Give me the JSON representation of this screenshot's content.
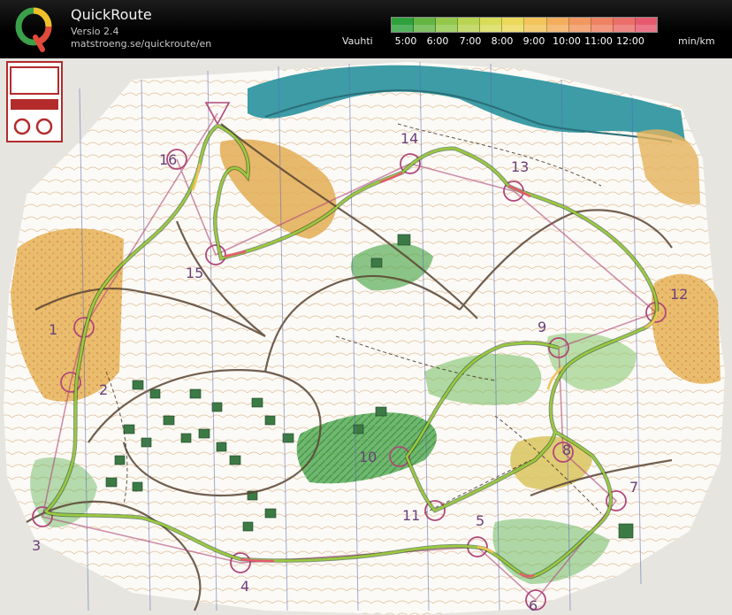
{
  "app": {
    "name": "QuickRoute",
    "version": "Versio 2.4",
    "url": "matstroeng.se/quickroute/en",
    "logo_letter": "Q"
  },
  "legend": {
    "label": "Vauhti",
    "unit": "min/km",
    "ticks": [
      "5:00",
      "6:00",
      "7:00",
      "8:00",
      "9:00",
      "10:00",
      "11:00",
      "12:00"
    ],
    "colors": [
      "#2fa13c",
      "#64b544",
      "#93c84b",
      "#b9d451",
      "#d8dc57",
      "#ecd85a",
      "#f2c45a",
      "#f3ad5c",
      "#f1975f",
      "#ee8263",
      "#ea6e69",
      "#e65a6f"
    ]
  },
  "map": {
    "controls": [
      {
        "id": "1",
        "label": "1"
      },
      {
        "id": "2",
        "label": "2"
      },
      {
        "id": "3",
        "label": "3"
      },
      {
        "id": "4",
        "label": "4"
      },
      {
        "id": "5",
        "label": "5"
      },
      {
        "id": "6",
        "label": "6"
      },
      {
        "id": "7",
        "label": "7"
      },
      {
        "id": "8",
        "label": "8"
      },
      {
        "id": "9",
        "label": "9"
      },
      {
        "id": "10",
        "label": "10"
      },
      {
        "id": "11",
        "label": "11"
      },
      {
        "id": "12",
        "label": "12"
      },
      {
        "id": "13",
        "label": "13"
      },
      {
        "id": "14",
        "label": "14"
      },
      {
        "id": "15",
        "label": "15"
      },
      {
        "id": "16",
        "label": "16"
      }
    ],
    "colors": {
      "paper": "#f3f1ec",
      "forest": "#ffffff",
      "open_land": "#e7b25a",
      "water": "#3a9aa5",
      "green": "#4ea84c",
      "route": "#9bc93e",
      "course": "#b0487a"
    }
  }
}
